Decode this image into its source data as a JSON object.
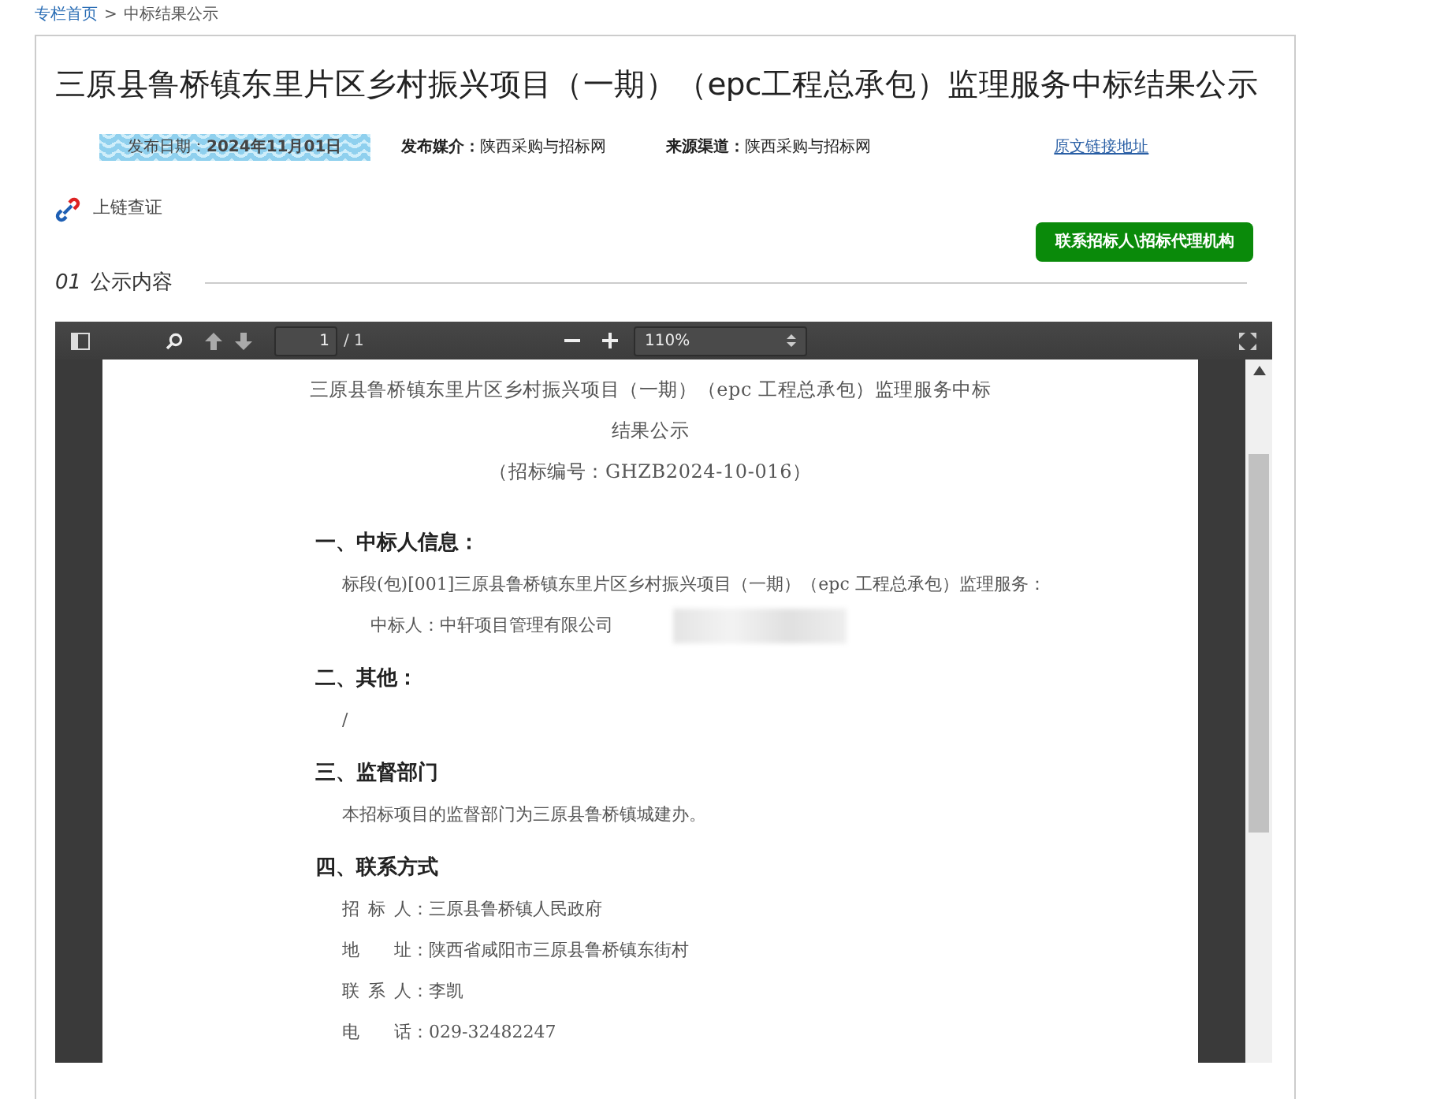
{
  "breadcrumb": [
    {
      "label": "专栏首页",
      "kind": "link"
    },
    {
      "label": ">",
      "kind": "separator"
    },
    {
      "label": "中标结果公示",
      "kind": "current"
    }
  ],
  "title": "三原县鲁桥镇东里片区乡村振兴项目（一期）（epc工程总承包）监理服务中标结果公示",
  "meta": {
    "date_label": "发布日期：",
    "date_value": "2024年11月01日",
    "media_label": "发布媒介：",
    "media_value": "陕西采购与招标网",
    "source_label": "来源渠道：",
    "source_value": "陕西采购与招标网",
    "original_link": "原文链接地址"
  },
  "chain_verify": "上链查证",
  "contact_button": "联系招标人\\招标代理机构",
  "section": {
    "number": "01",
    "label": "公示内容"
  },
  "viewer": {
    "page": "1",
    "page_total": "/ 1",
    "zoom": "110%"
  },
  "document": {
    "title_lines": [
      "三原县鲁桥镇东里片区乡村振兴项目（一期）（epc 工程总承包）监理服务中标",
      "结果公示"
    ],
    "code": "（招标编号：GHZB2024-10-016）",
    "blocks": [
      {
        "kind": "heading",
        "text": "一、中标人信息："
      },
      {
        "kind": "para",
        "text": "标段(包)[001]三原县鲁桥镇东里片区乡村振兴项目（一期）（epc 工程总承包）监理服务："
      },
      {
        "kind": "field",
        "text": "中标人：中轩项目管理有限公司",
        "redacted": true
      },
      {
        "kind": "heading",
        "text": "二、其他："
      },
      {
        "kind": "para",
        "text": "/"
      },
      {
        "kind": "heading",
        "text": "三、监督部门"
      },
      {
        "kind": "para",
        "text": "本招标项目的监督部门为三原县鲁桥镇城建办。"
      },
      {
        "kind": "heading",
        "text": "四、联系方式"
      },
      {
        "kind": "contact",
        "label": "招标人",
        "value": "：三原县鲁桥镇人民政府"
      },
      {
        "kind": "contact",
        "label": "地址",
        "value": "：陕西省咸阳市三原县鲁桥镇东街村"
      },
      {
        "kind": "contact",
        "label": "联系人",
        "value": "：李凯"
      },
      {
        "kind": "contact",
        "label": "电话",
        "value": "：029-32482247"
      }
    ]
  }
}
